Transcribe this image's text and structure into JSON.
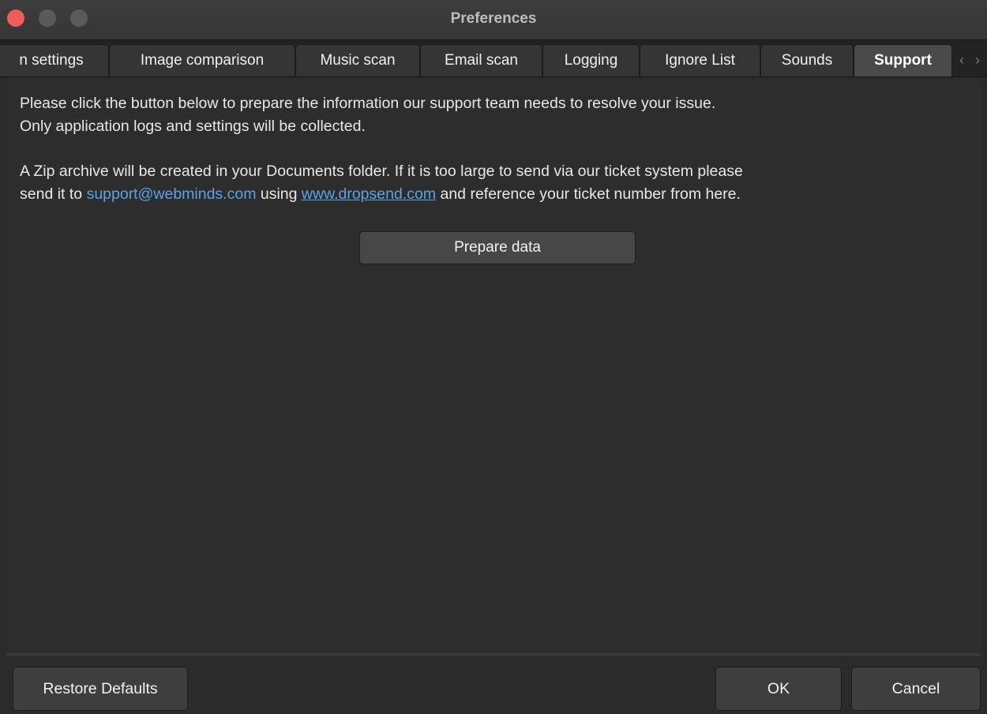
{
  "window": {
    "title": "Preferences"
  },
  "tabs": [
    {
      "label": "n settings",
      "active": false
    },
    {
      "label": "Image comparison",
      "active": false
    },
    {
      "label": "Music scan",
      "active": false
    },
    {
      "label": "Email scan",
      "active": false
    },
    {
      "label": "Logging",
      "active": false
    },
    {
      "label": "Ignore List",
      "active": false
    },
    {
      "label": "Sounds",
      "active": false
    },
    {
      "label": "Support",
      "active": true
    }
  ],
  "tab_scroll": {
    "left_icon": "‹",
    "right_icon": "›"
  },
  "support": {
    "paragraph1_line1": "Please click the button below to prepare the information our support team needs to resolve your issue.",
    "paragraph1_line2": "Only application logs and settings will be collected.",
    "paragraph2_line1": "A Zip archive will be created in your Documents folder. If it is too large to send via our ticket system please",
    "paragraph2_prefix": "send it to ",
    "support_email": "support@webminds.com",
    "paragraph2_middle": " using ",
    "dropsend_link": "www.dropsend.com",
    "paragraph2_suffix": " and reference your ticket number from here.",
    "prepare_button": "Prepare data"
  },
  "footer": {
    "restore_defaults": "Restore Defaults",
    "ok": "OK",
    "cancel": "Cancel"
  },
  "colors": {
    "close_button": "#ee5d58",
    "link": "#5aa3e6",
    "background": "#2d2d2d"
  }
}
